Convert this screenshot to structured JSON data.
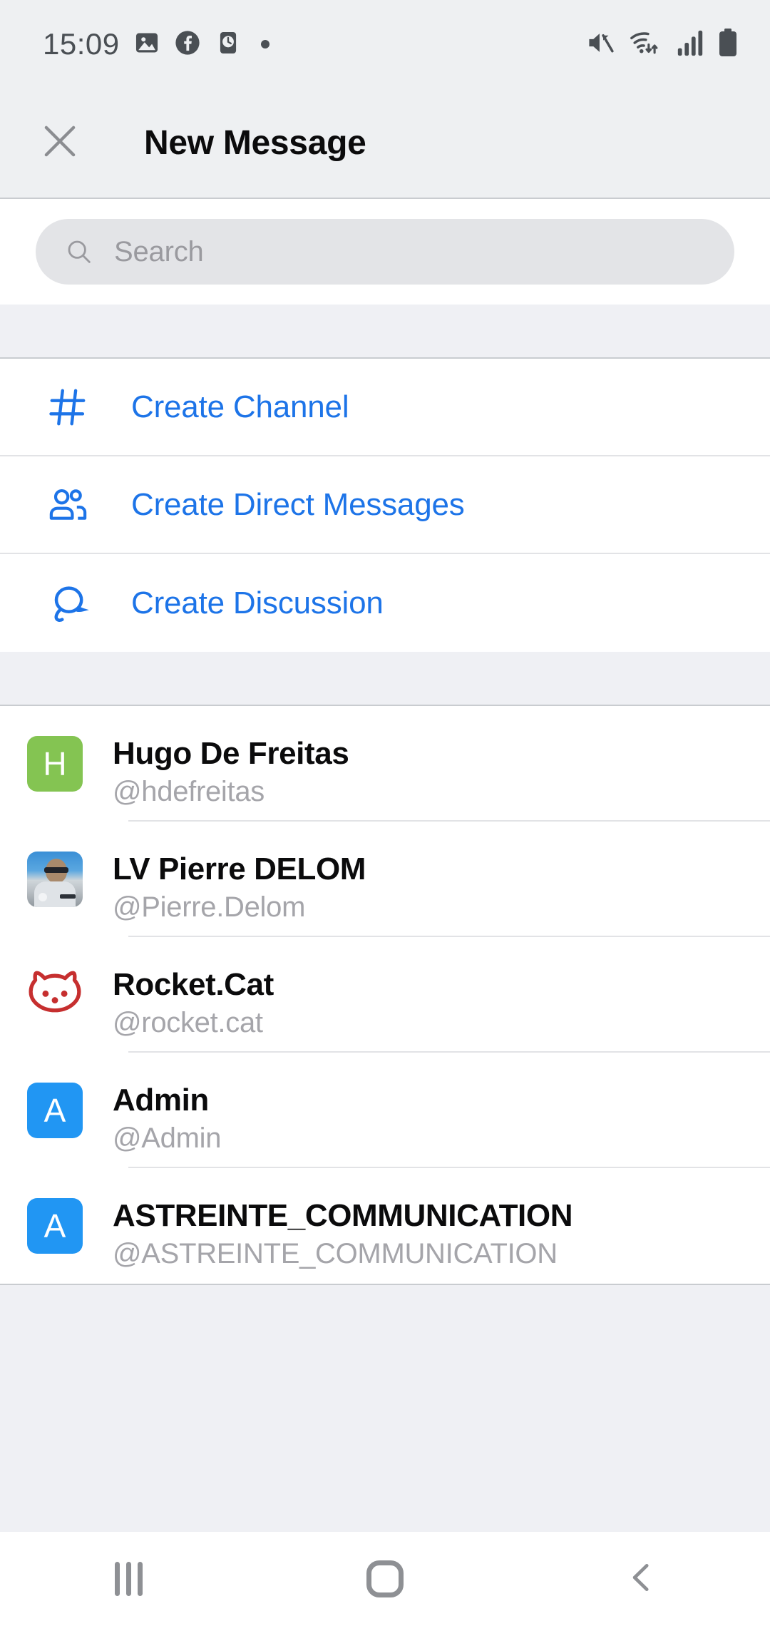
{
  "status_bar": {
    "time": "15:09",
    "left_icons": [
      "photo-icon",
      "facebook-icon",
      "clock-app-icon",
      "notification-dot"
    ],
    "right_icons": [
      "mute-icon",
      "wifi-icon",
      "cellular-signal-icon",
      "battery-icon"
    ]
  },
  "header": {
    "close_icon": "close-icon",
    "title": "New Message"
  },
  "search": {
    "icon": "search-icon",
    "placeholder": "Search",
    "value": ""
  },
  "actions": [
    {
      "icon": "hash-icon",
      "label": "Create Channel"
    },
    {
      "icon": "people-icon",
      "label": "Create Direct Messages"
    },
    {
      "icon": "discussion-icon",
      "label": "Create Discussion"
    }
  ],
  "users": [
    {
      "name": "Hugo De Freitas",
      "handle": "@hdefreitas",
      "avatar_type": "letter",
      "avatar_letter": "H",
      "avatar_color": "#84c452"
    },
    {
      "name": "LV Pierre DELOM",
      "handle": "@Pierre.Delom",
      "avatar_type": "photo",
      "avatar_letter": "",
      "avatar_color": "#5aa7e0"
    },
    {
      "name": "Rocket.Cat",
      "handle": "@rocket.cat",
      "avatar_type": "cat",
      "avatar_letter": "",
      "avatar_color": "#c62f2f"
    },
    {
      "name": "Admin",
      "handle": "@Admin",
      "avatar_type": "letter",
      "avatar_letter": "A",
      "avatar_color": "#2196f3"
    },
    {
      "name": "ASTREINTE_COMMUNICATION",
      "handle": "@ASTREINTE_COMMUNICATION",
      "avatar_type": "letter",
      "avatar_letter": "A",
      "avatar_color": "#2196f3"
    }
  ],
  "nav_bar": {
    "recents_label": "recents-icon",
    "home_label": "home-icon",
    "back_label": "back-icon"
  },
  "colors": {
    "accent_blue": "#1d74e8",
    "chrome_gray": "#eef0f2",
    "band_gray": "#eff0f4",
    "search_gray": "#e3e4e7",
    "divider": "#e2e3e6",
    "handle_gray": "#a5a5aa"
  }
}
